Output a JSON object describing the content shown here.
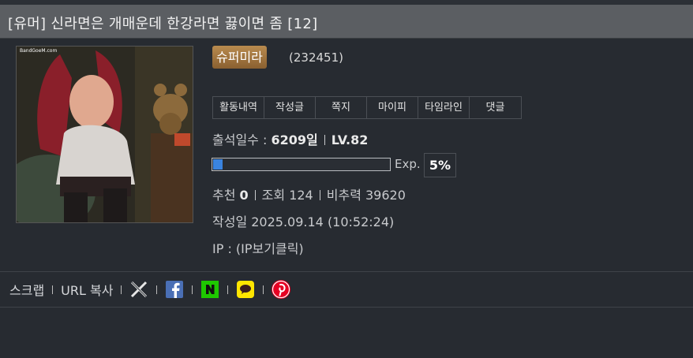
{
  "post": {
    "title": "[유머] 신라면은 개매운데 한강라면 끓이면 좀 [12]"
  },
  "author": {
    "avatar_watermark": "BandGoeM.com",
    "nickname": "슈퍼미라",
    "user_id": "(232451)",
    "menu": [
      "활동내역",
      "작성글",
      "쪽지",
      "마이피",
      "타임라인",
      "댓글"
    ]
  },
  "stats": {
    "attendance_label": "출석일수 : ",
    "attendance_value": "6209일",
    "level": "LV.82",
    "exp_label": "Exp.",
    "exp_percent": "5%",
    "exp_fraction": 0.05,
    "recommend_label": "추천 ",
    "recommend_value": "0",
    "views": "조회 124",
    "ratio": "비추력 39620",
    "written": "작성일 2025.09.14 (10:52:24)",
    "ip": "IP : (IP보기클릭)"
  },
  "share": {
    "scrap": "스크랩",
    "copy_url": "URL 복사",
    "icons": [
      "x-icon",
      "facebook-icon",
      "naver-icon",
      "kakaotalk-icon",
      "pinterest-icon"
    ]
  },
  "colors": {
    "background": "#272b31",
    "title_bar": "#5b5e62",
    "badge": "#a87a40",
    "exp_fill": "#3a84e0"
  }
}
